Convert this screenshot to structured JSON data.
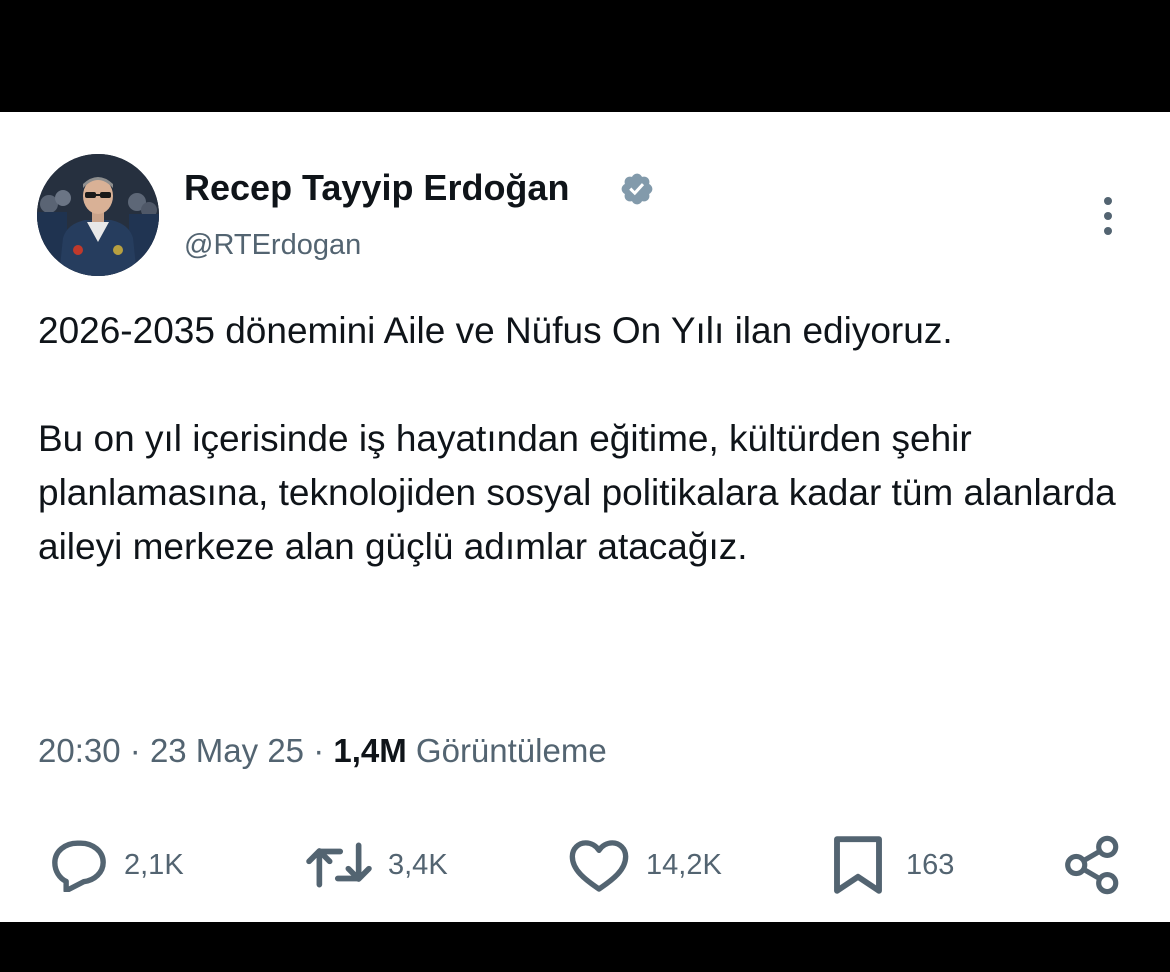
{
  "author": {
    "display_name": "Recep Tayyip Erdoğan",
    "handle": "@RTErdogan",
    "verified_icon": "verified-badge-icon",
    "avatar_icon": "profile-photo"
  },
  "tweet": {
    "paragraphs": [
      "2026-2035 dönemini Aile ve Nüfus On Yılı ilan ediyoruz.",
      "Bu on yıl içerisinde iş hayatından eğitime, kültürden şehir planlamasına, teknolojiden sosyal politikalara kadar tüm alanlarda aileyi merkeze alan güçlü adımlar atacağız."
    ]
  },
  "meta": {
    "time": "20:30",
    "separator": "·",
    "date": "23 May 25",
    "views_count": "1,4M",
    "views_label": "Görüntüleme"
  },
  "actions": {
    "replies": {
      "icon": "reply-icon",
      "count": "2,1K"
    },
    "reposts": {
      "icon": "repost-icon",
      "count": "3,4K"
    },
    "likes": {
      "icon": "heart-icon",
      "count": "14,2K"
    },
    "bookmarks": {
      "icon": "bookmark-icon",
      "count": "163"
    },
    "share": {
      "icon": "share-icon"
    }
  },
  "colors": {
    "text_primary": "#0f1419",
    "text_secondary": "#536471",
    "background": "#ffffff",
    "frame": "#000000"
  }
}
